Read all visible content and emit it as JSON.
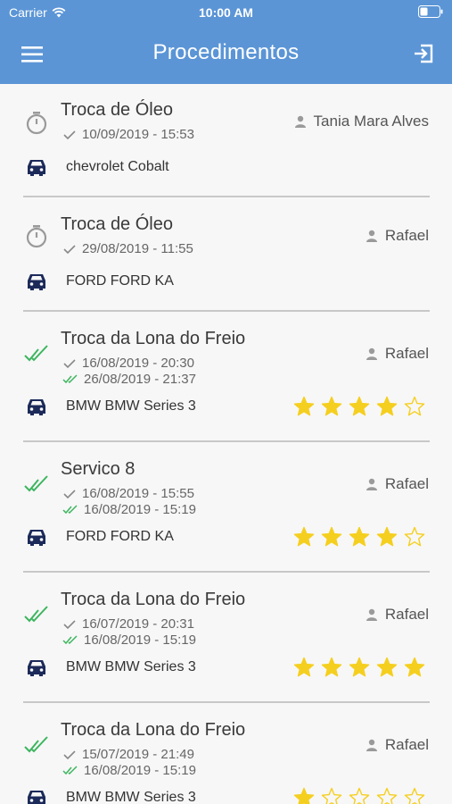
{
  "status_bar": {
    "carrier": "Carrier",
    "time": "10:00 AM"
  },
  "header": {
    "title": "Procedimentos"
  },
  "colors": {
    "accent": "#5b95d6",
    "star": "#f5cf1f",
    "done_check": "#3cb55e",
    "car": "#1c2a5a"
  },
  "items": [
    {
      "title": "Troca de Óleo",
      "status": "pending",
      "date1": "10/09/2019 - 15:53",
      "person": "Tania Mara Alves",
      "car": "chevrolet Cobalt"
    },
    {
      "title": "Troca de Óleo",
      "status": "pending",
      "date1": "29/08/2019 - 11:55",
      "person": "Rafael",
      "car": "FORD FORD KA"
    },
    {
      "title": "Troca da Lona do Freio",
      "status": "done",
      "date1": "16/08/2019 - 20:30",
      "date2": "26/08/2019 - 21:37",
      "person": "Rafael",
      "car": "BMW BMW Series 3",
      "rating": 4
    },
    {
      "title": "Servico 8",
      "status": "done",
      "date1": "16/08/2019 - 15:55",
      "date2": "16/08/2019 - 15:19",
      "person": "Rafael",
      "car": "FORD FORD KA",
      "rating": 4
    },
    {
      "title": "Troca da Lona do Freio",
      "status": "done",
      "date1": "16/07/2019 - 20:31",
      "date2": "16/08/2019 - 15:19",
      "person": "Rafael",
      "car": "BMW BMW Series 3",
      "rating": 5
    },
    {
      "title": "Troca da Lona do Freio",
      "status": "done",
      "date1": "15/07/2019 - 21:49",
      "date2": "16/08/2019 - 15:19",
      "person": "Rafael",
      "car": "BMW BMW Series 3",
      "rating": 1
    }
  ]
}
